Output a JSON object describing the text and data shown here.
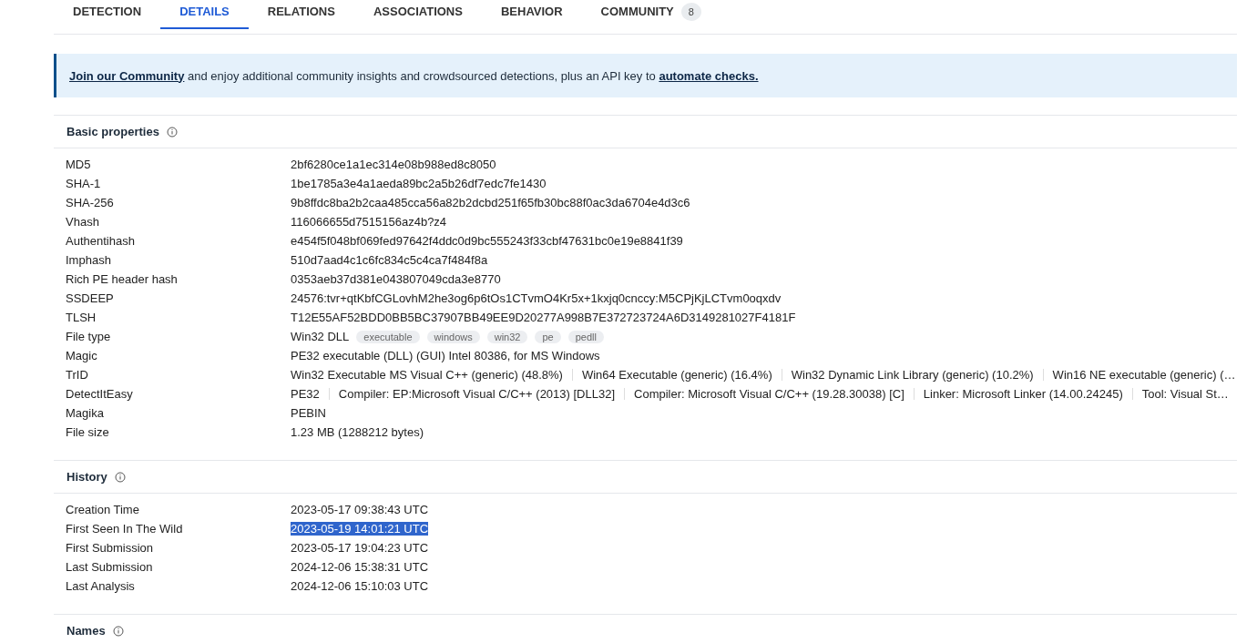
{
  "tabs": [
    {
      "label": "DETECTION",
      "selected": false
    },
    {
      "label": "DETAILS",
      "selected": true
    },
    {
      "label": "RELATIONS",
      "selected": false
    },
    {
      "label": "ASSOCIATIONS",
      "selected": false
    },
    {
      "label": "BEHAVIOR",
      "selected": false
    },
    {
      "label": "COMMUNITY",
      "selected": false,
      "badge": "8"
    }
  ],
  "banner": {
    "parts": [
      {
        "kind": "link",
        "text": "Join our Community"
      },
      {
        "kind": "text",
        "text": " and enjoy additional community insights and crowdsourced detections, plus an API key to "
      },
      {
        "kind": "link",
        "text": "automate checks."
      }
    ]
  },
  "sections": [
    {
      "title": "Basic properties",
      "rows": [
        {
          "kind": "text",
          "label": "MD5",
          "value": "2bf6280ce1a1ec314e08b988ed8c8050",
          "highlighted": false
        },
        {
          "kind": "text",
          "label": "SHA-1",
          "value": "1be1785a3e4a1aeda89bc2a5b26df7edc7fe1430",
          "highlighted": false
        },
        {
          "kind": "text",
          "label": "SHA-256",
          "value": "9b8ffdc8ba2b2caa485cca56a82b2dcbd251f65fb30bc88f0ac3da6704e4d3c6",
          "highlighted": false
        },
        {
          "kind": "text",
          "label": "Vhash",
          "value": "116066655d7515156az4b?z4",
          "highlighted": false
        },
        {
          "kind": "text",
          "label": "Authentihash",
          "value": "e454f5f048bf069fed97642f4ddc0d9bc555243f33cbf47631bc0e19e8841f39",
          "highlighted": false
        },
        {
          "kind": "text",
          "label": "Imphash",
          "value": "510d7aad4c1c6fc834c5c4ca7f484f8a",
          "highlighted": false
        },
        {
          "kind": "text",
          "label": "Rich PE header hash",
          "value": "0353aeb37d381e043807049cda3e8770",
          "highlighted": false
        },
        {
          "kind": "text",
          "label": "SSDEEP",
          "value": "24576:tvr+qtKbfCGLovhM2he3og6p6tOs1CTvmO4Kr5x+1kxjq0cnccy:M5CPjKjLCTvm0oqxdv",
          "highlighted": false
        },
        {
          "kind": "text",
          "label": "TLSH",
          "value": "T12E55AF52BDD0BB5BC37907BB49EE9D20277A998B7E372723724A6D3149281027F4181F",
          "highlighted": false
        },
        {
          "kind": "tags",
          "label": "File type",
          "value": "Win32 DLL",
          "tags": [
            "executable",
            "windows",
            "win32",
            "pe",
            "pedll"
          ]
        },
        {
          "kind": "text",
          "label": "Magic",
          "value": "PE32 executable (DLL) (GUI) Intel 80386, for MS Windows",
          "highlighted": false
        },
        {
          "kind": "parts",
          "label": "TrID",
          "parts": [
            "Win32 Executable MS Visual C++ (generic) (48.8%)",
            "Win64 Executable (generic) (16.4%)",
            "Win32 Dynamic Link Library (generic) (10.2%)",
            "Win16 NE executable (generic) (…"
          ]
        },
        {
          "kind": "parts",
          "label": "DetectItEasy",
          "parts": [
            "PE32",
            "Compiler: EP:Microsoft Visual C/C++ (2013) [DLL32]",
            "Compiler: Microsoft Visual C/C++ (19.28.30038) [C]",
            "Linker: Microsoft Linker (14.00.24245)",
            "Tool: Visual St…"
          ]
        },
        {
          "kind": "text",
          "label": "Magika",
          "value": "PEBIN",
          "highlighted": false
        },
        {
          "kind": "text",
          "label": "File size",
          "value": "1.23 MB (1288212 bytes)",
          "highlighted": false
        }
      ]
    },
    {
      "title": "History",
      "rows": [
        {
          "kind": "text",
          "label": "Creation Time",
          "value": "2023-05-17 09:38:43 UTC",
          "highlighted": false
        },
        {
          "kind": "text",
          "label": "First Seen In The Wild",
          "value": "2023-05-19 14:01:21 UTC",
          "highlighted": true
        },
        {
          "kind": "text",
          "label": "First Submission",
          "value": "2023-05-17 19:04:23 UTC",
          "highlighted": false
        },
        {
          "kind": "text",
          "label": "Last Submission",
          "value": "2024-12-06 15:38:31 UTC",
          "highlighted": false
        },
        {
          "kind": "text",
          "label": "Last Analysis",
          "value": "2024-12-06 15:10:03 UTC",
          "highlighted": false
        }
      ]
    },
    {
      "title": "Names"
    }
  ]
}
